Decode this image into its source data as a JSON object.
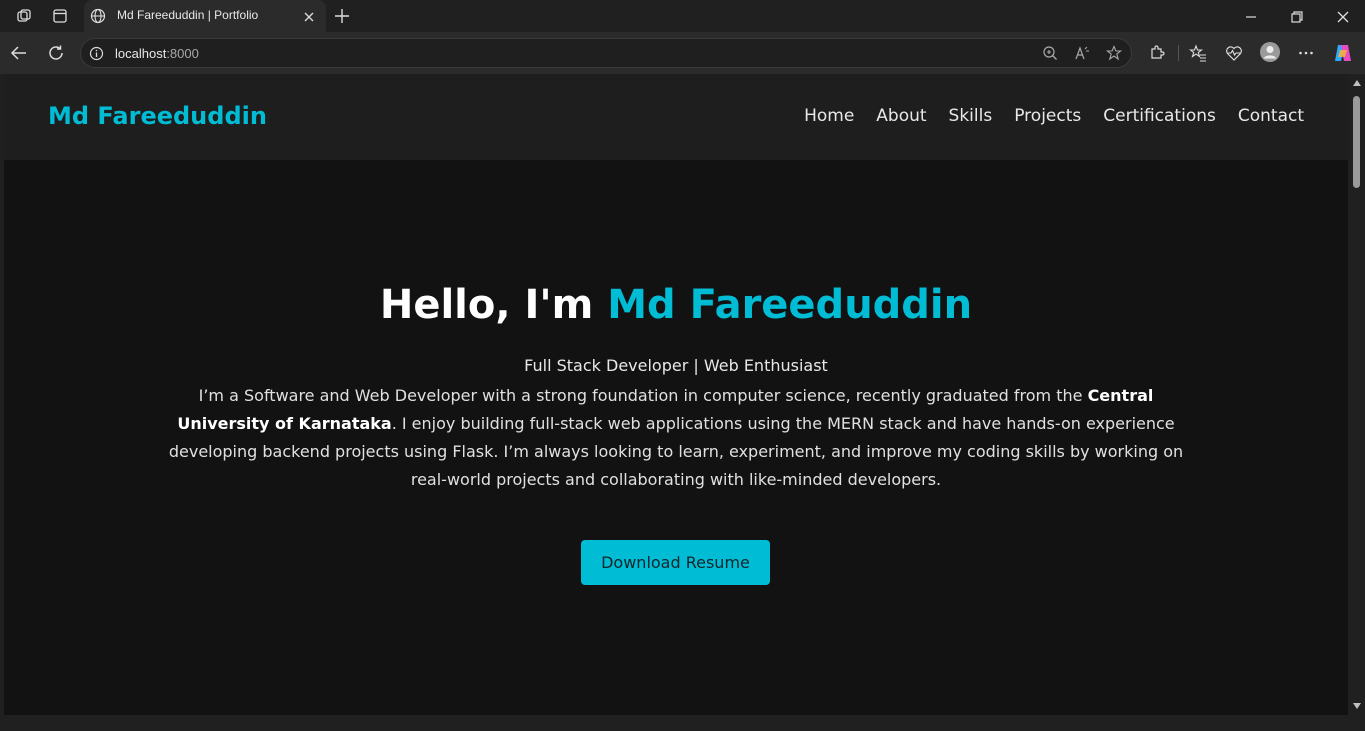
{
  "browser": {
    "tab": {
      "title": "Md Fareeduddin | Portfolio"
    },
    "address": {
      "host": "localhost",
      "port": ":8000"
    }
  },
  "site": {
    "brand": "Md Fareeduddin",
    "nav": [
      "Home",
      "About",
      "Skills",
      "Projects",
      "Certifications",
      "Contact"
    ]
  },
  "hero": {
    "greeting": "Hello, I'm ",
    "name": "Md Fareeduddin",
    "subtitle": "Full Stack Developer | Web Enthusiast",
    "bio_before": "I’m a Software and Web Developer with a strong foundation in computer science, recently graduated from the ",
    "bio_bold": "Central University of Karnataka",
    "bio_after": ". I enjoy building full-stack web applications using the MERN stack and have hands-on experience developing backend projects using Flask. I’m always looking to learn, experiment, and improve my coding skills by working on real-world projects and collaborating with like-minded developers.",
    "button": "Download Resume"
  },
  "colors": {
    "accent": "#00bcd4",
    "page_bg": "#121212",
    "header_bg": "#1e1e1e"
  }
}
